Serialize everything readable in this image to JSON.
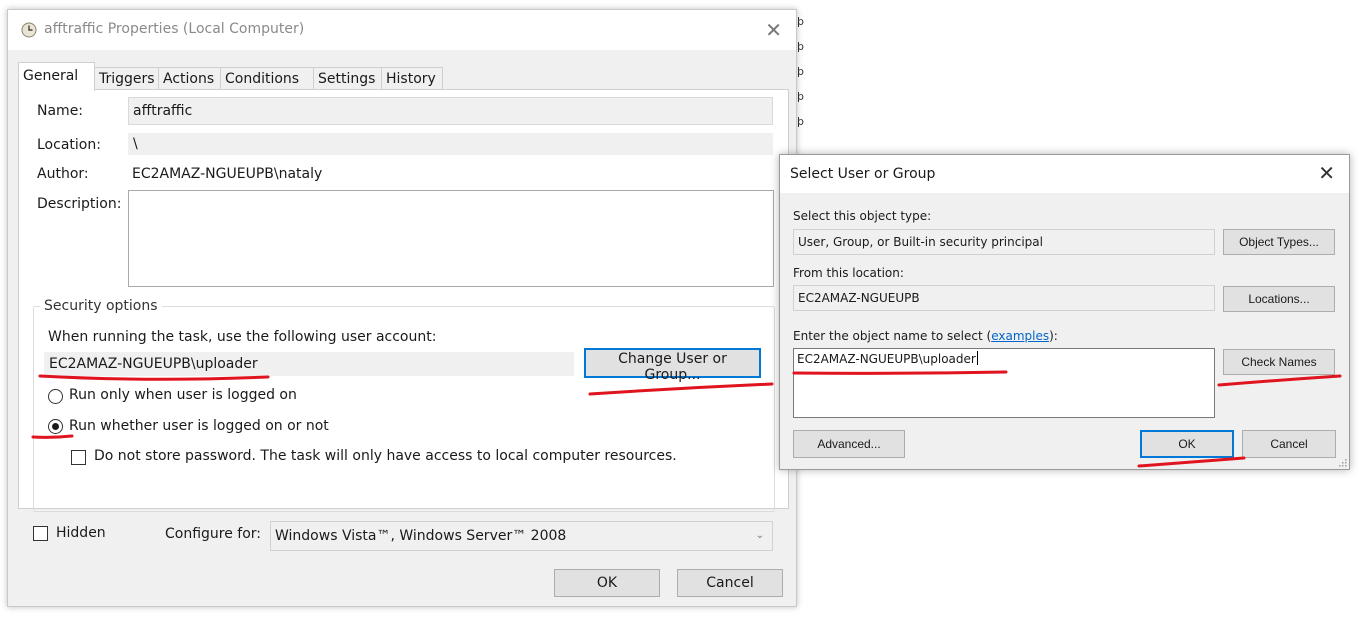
{
  "properties_dialog": {
    "title": "afftraffic Properties (Local Computer)",
    "tabs": [
      {
        "label": "General",
        "active": true
      },
      {
        "label": "Triggers",
        "active": false
      },
      {
        "label": "Actions",
        "active": false
      },
      {
        "label": "Conditions",
        "active": false
      },
      {
        "label": "Settings",
        "active": false
      },
      {
        "label": "History",
        "active": false
      }
    ],
    "general": {
      "name_label": "Name:",
      "name_value": "afftraffic",
      "location_label": "Location:",
      "location_value": "\\",
      "author_label": "Author:",
      "author_value": "EC2AMAZ-NGUEUPB\\nataly",
      "description_label": "Description:",
      "description_value": ""
    },
    "security": {
      "group_title": "Security options",
      "account_prompt": "When running the task, use the following user account:",
      "account_value": "EC2AMAZ-NGUEUPB\\uploader",
      "change_button": "Change User or Group...",
      "radio_logged_on": "Run only when user is logged on",
      "radio_whether": "Run whether user is logged on or not",
      "selected_radio": "whether",
      "no_store_password": "Do not store password.  The task will only have access to local computer resources.",
      "no_store_password_checked": false
    },
    "hidden_label": "Hidden",
    "hidden_checked": false,
    "configure_label": "Configure for:",
    "configure_value": "Windows Vista™, Windows Server™ 2008",
    "ok_button": "OK",
    "cancel_button": "Cancel"
  },
  "select_dialog": {
    "title": "Select User or Group",
    "object_type_label": "Select this object type:",
    "object_type_value": "User, Group, or Built-in security principal",
    "object_types_button": "Object Types...",
    "location_label": "From this location:",
    "location_value": "EC2AMAZ-NGUEUPB",
    "locations_button": "Locations...",
    "enter_name_prefix": "Enter the object name to select (",
    "enter_name_link": "examples",
    "enter_name_suffix": "):",
    "object_name_value": "EC2AMAZ-NGUEUPB\\uploader",
    "check_names_button": "Check Names",
    "advanced_button": "Advanced...",
    "ok_button": "OK",
    "cancel_button": "Cancel"
  },
  "colors": {
    "annotation_red": "#e0141e",
    "focus_blue": "#0078d7",
    "link_blue": "#0066cc"
  }
}
